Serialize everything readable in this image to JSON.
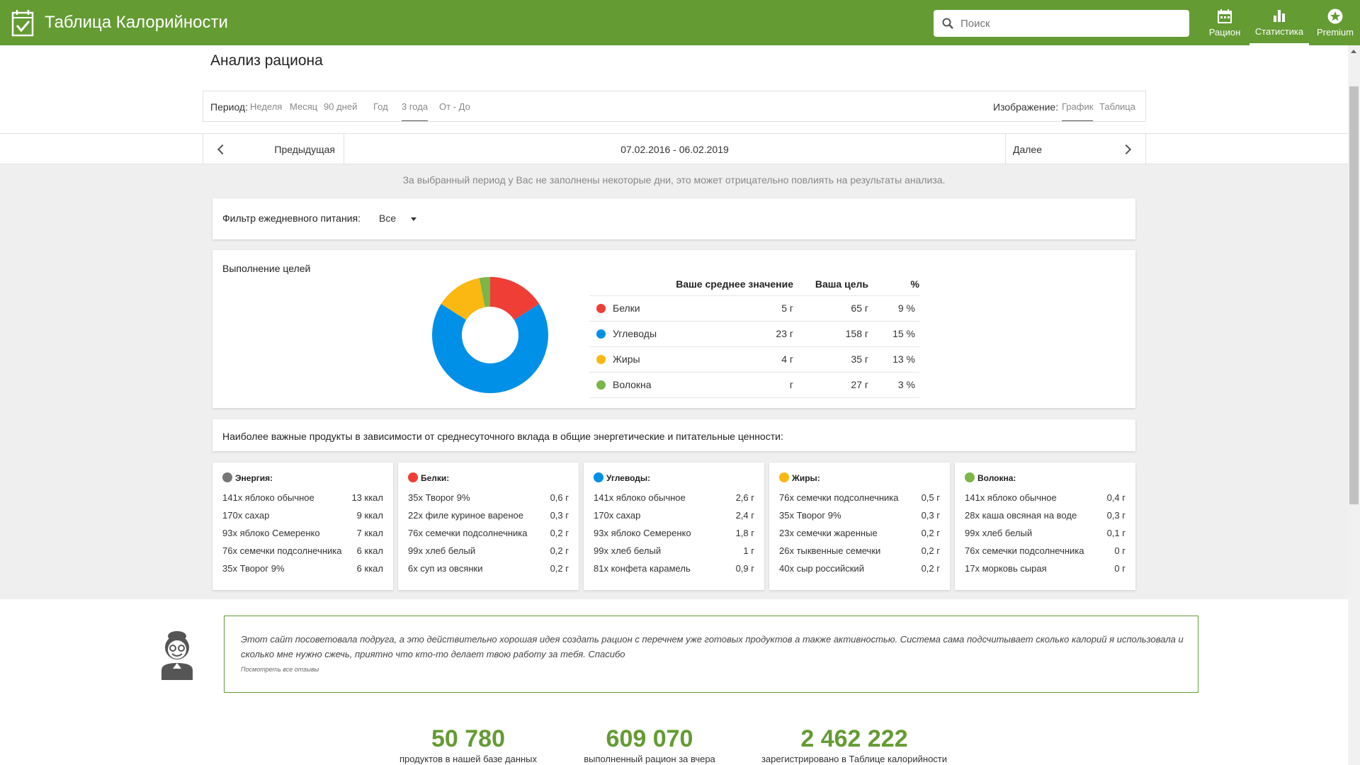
{
  "header": {
    "app_title": "Таблица Калорийности",
    "search_placeholder": "Поиск",
    "nav": [
      {
        "label": "Рацион",
        "icon": "calendar-icon"
      },
      {
        "label": "Статистика",
        "icon": "bar-chart-icon",
        "active": true
      },
      {
        "label": "Premium",
        "icon": "star-icon"
      }
    ],
    "brand_color": "#649b33"
  },
  "page": {
    "title": "Анализ рациона",
    "period_label": "Период:",
    "period_options": [
      "Неделя",
      "Месяц",
      "90 дней",
      "Год",
      "3 года",
      "От - До"
    ],
    "period_selected": "3 года",
    "view_label": "Изображение:",
    "view_options": [
      "График",
      "Таблица"
    ],
    "view_selected": "График",
    "prev_label": "Предыдущая",
    "date_range": "07.02.2016 - 06.02.2019",
    "next_label": "Далее",
    "notice": "За выбранный период у Вас не заполнены некоторые дни, это может отрицательно повлиять на результаты анализа."
  },
  "filter": {
    "label": "Фильтр ежедневного питания:",
    "value": "Все"
  },
  "goals": {
    "title": "Выполнение целей",
    "headers": [
      "Ваше среднее значение",
      "Ваша цель",
      "%"
    ],
    "rows": [
      {
        "name": "Белки",
        "color": "#ef3e36",
        "avg": "5 г",
        "goal": "65 г",
        "pct": "9 %"
      },
      {
        "name": "Углеводы",
        "color": "#0090e7",
        "avg": "23 г",
        "goal": "158 г",
        "pct": "15 %"
      },
      {
        "name": "Жиры",
        "color": "#fbb712",
        "avg": "4 г",
        "goal": "35 г",
        "pct": "13 %"
      },
      {
        "name": "Волокна",
        "color": "#7ab648",
        "avg": "г",
        "goal": "27 г",
        "pct": "3 %"
      }
    ]
  },
  "chart_data": {
    "type": "pie",
    "donut": true,
    "categories": [
      "Белки",
      "Углеводы",
      "Жиры",
      "Волокна"
    ],
    "values": [
      16,
      68,
      13,
      3
    ],
    "colors": [
      "#ef3e36",
      "#0090e7",
      "#fbb712",
      "#7ab648"
    ]
  },
  "important": {
    "title": "Наиболее важные продукты в зависимости от среднесуточного вклада в общие энергетические и питательные ценности:",
    "groups": [
      {
        "name": "Энергия:",
        "color": "#777777",
        "items": [
          {
            "product": "141x яблоко обычное",
            "value": "13 ккал"
          },
          {
            "product": "170x сахар",
            "value": "9 ккал"
          },
          {
            "product": "93x яблоко Семеренко",
            "value": "7 ккал"
          },
          {
            "product": "76x семечки подсолнечника",
            "value": "6 ккал"
          },
          {
            "product": "35x Творог 9%",
            "value": "6 ккал"
          }
        ]
      },
      {
        "name": "Белки:",
        "color": "#ef3e36",
        "items": [
          {
            "product": "35x Творог 9%",
            "value": "0,6 г"
          },
          {
            "product": "22x филе куриное вареное",
            "value": "0,3 г"
          },
          {
            "product": "76x семечки подсолнечника",
            "value": "0,2 г"
          },
          {
            "product": "99x хлеб белый",
            "value": "0,2 г"
          },
          {
            "product": "6x суп из овсянки",
            "value": "0,2 г"
          }
        ]
      },
      {
        "name": "Углеводы:",
        "color": "#0090e7",
        "items": [
          {
            "product": "141x яблоко обычное",
            "value": "2,6 г"
          },
          {
            "product": "170x сахар",
            "value": "2,4 г"
          },
          {
            "product": "93x яблоко Семеренко",
            "value": "1,8 г"
          },
          {
            "product": "99x хлеб белый",
            "value": "1 г"
          },
          {
            "product": "81x конфета карамель",
            "value": "0,9 г"
          }
        ]
      },
      {
        "name": "Жиры:",
        "color": "#fbb712",
        "items": [
          {
            "product": "76x семечки подсолнечника",
            "value": "0,5 г"
          },
          {
            "product": "35x Творог 9%",
            "value": "0,3 г"
          },
          {
            "product": "23x семечки жаренные",
            "value": "0,2 г"
          },
          {
            "product": "26x тыквенные семечки",
            "value": "0,2 г"
          },
          {
            "product": "40x сыр российский",
            "value": "0,2 г"
          }
        ]
      },
      {
        "name": "Волокна:",
        "color": "#7ab648",
        "items": [
          {
            "product": "141x яблоко обычное",
            "value": "0,4 г"
          },
          {
            "product": "28x каша овсяная на воде",
            "value": "0,3 г"
          },
          {
            "product": "99x хлеб белый",
            "value": "0,1 г"
          },
          {
            "product": "76x семечки подсолнечника",
            "value": "0 г"
          },
          {
            "product": "17x морковь сырая",
            "value": "0 г"
          }
        ]
      }
    ]
  },
  "testimonial": {
    "text": "Этот сайт посоветовала подруга, а это действительно хорошая идея создать рацион с перечнем уже готовых продуктов а также активностью. Система сама подсчитывает сколько калорий я использовала и сколько мне нужно сжечь, приятно что кто-то делает твою работу за тебя. Спасибо",
    "link": "Посмотреть все отзывы"
  },
  "stats": [
    {
      "number": "50 780",
      "label": "продуктов в нашей базе данных"
    },
    {
      "number": "609 070",
      "label": "выполненный рацион за вчера"
    },
    {
      "number": "2 462 222",
      "label": "зарегистрировано в Таблице калорийности"
    }
  ]
}
